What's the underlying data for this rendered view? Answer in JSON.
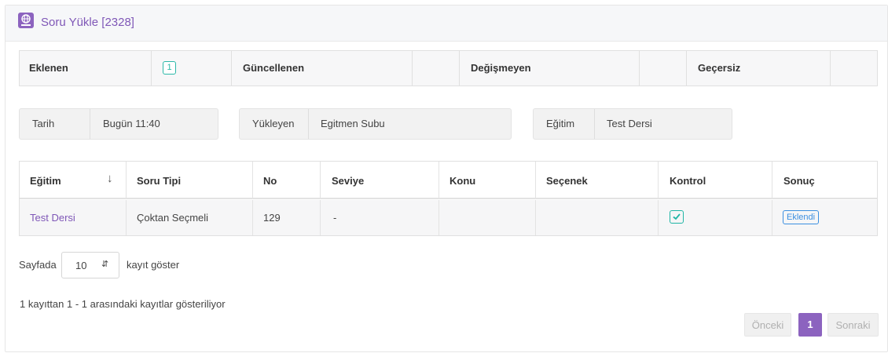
{
  "header": {
    "title": "Soru Yükle [2328]",
    "icon": "globe-book-icon"
  },
  "summary": {
    "added_label": "Eklenen",
    "added_count": "1",
    "updated_label": "Güncellenen",
    "unchanged_label": "Değişmeyen",
    "invalid_label": "Geçersiz"
  },
  "info": {
    "date_label": "Tarih",
    "date_value": "Bugün 11:40",
    "uploader_label": "Yükleyen",
    "uploader_value": "Egitmen Subu",
    "course_label": "Eğitim",
    "course_value": "Test Dersi"
  },
  "table": {
    "columns": [
      "Eğitim",
      "Soru Tipi",
      "No",
      "Seviye",
      "Konu",
      "Seçenek",
      "Kontrol",
      "Sonuç"
    ],
    "sort_icon": "arrow-down-icon",
    "rows": [
      {
        "course": "Test Dersi",
        "type": "Çoktan Seçmeli",
        "no": "129",
        "level": "-",
        "topic": "",
        "option": "",
        "check": "check-icon",
        "result": "Eklendi"
      }
    ]
  },
  "pagination": {
    "show_prefix": "Sayfada",
    "page_size": "10",
    "show_suffix": "kayıt göster",
    "info": "1 kayıttan 1 - 1 arasındaki kayıtlar gösteriliyor",
    "prev": "Önceki",
    "current": "1",
    "next": "Sonraki"
  },
  "colors": {
    "accent": "#8c63bf",
    "success": "#1fb5a5",
    "info": "#3b8fe0"
  }
}
